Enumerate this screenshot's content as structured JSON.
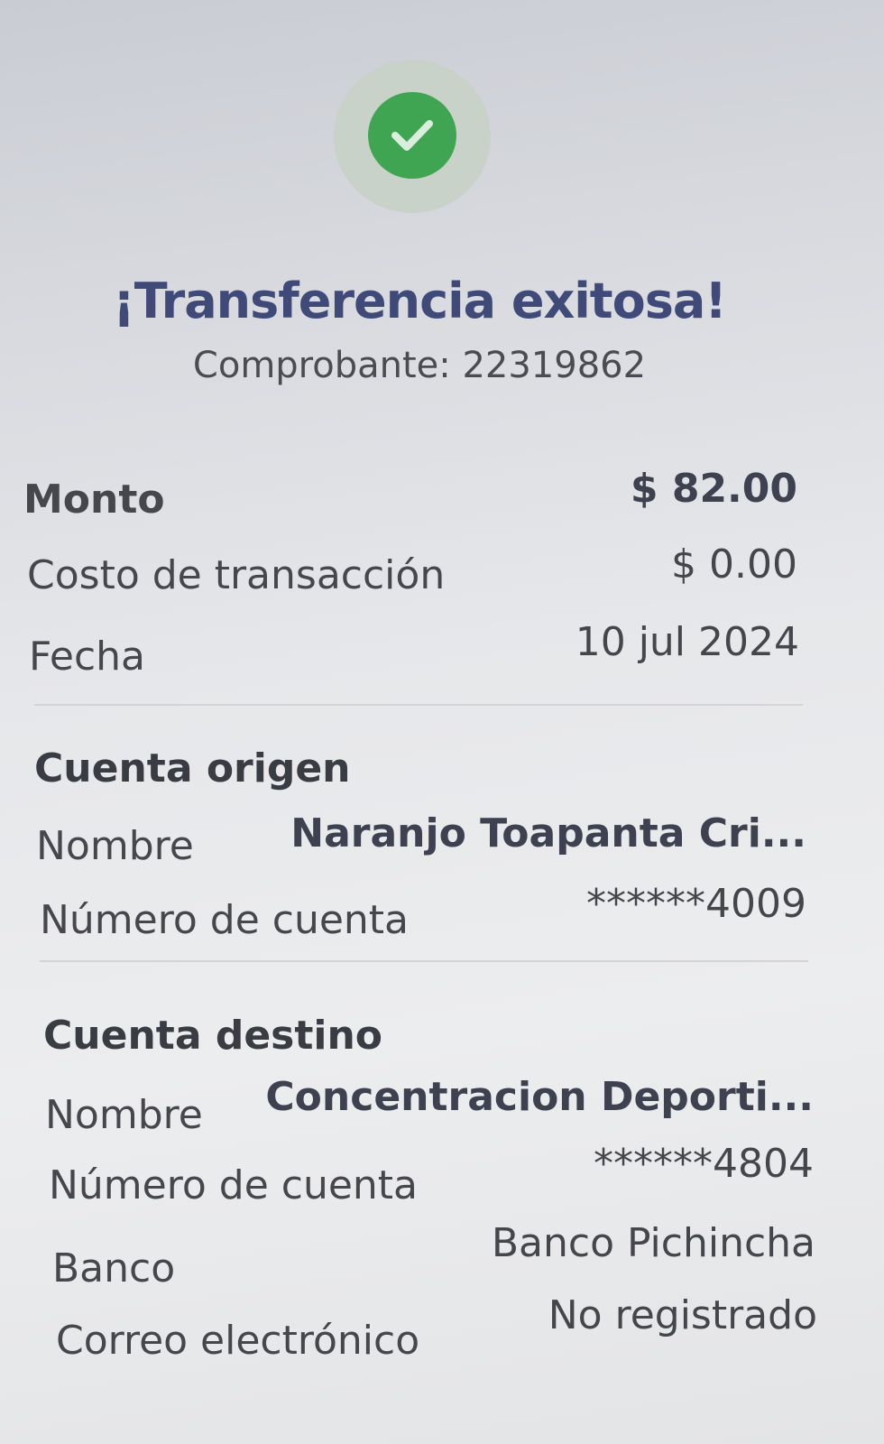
{
  "header": {
    "icon": "checkmark-icon",
    "title": "¡Transferencia exitosa!",
    "comprobante": "Comprobante: 22319862"
  },
  "summary": {
    "monto_label": "Monto",
    "monto_value": "$ 82.00",
    "costo_label": "Costo de transacción",
    "costo_value": "$ 0.00",
    "fecha_label": "Fecha",
    "fecha_value": "10 jul 2024"
  },
  "origen": {
    "title": "Cuenta origen",
    "nombre_label": "Nombre",
    "nombre_value": "Naranjo  Toapanta Cri...",
    "cuenta_label": "Número de cuenta",
    "cuenta_value": "******4009"
  },
  "destino": {
    "title": "Cuenta destino",
    "nombre_label": "Nombre",
    "nombre_value": "Concentracion Deporti...",
    "cuenta_label": "Número de cuenta",
    "cuenta_value": "******4804",
    "banco_label": "Banco",
    "banco_value": "Banco Pichincha",
    "correo_label": "Correo electrónico",
    "correo_value": "No registrado"
  },
  "colors": {
    "success_green": "#3fa552",
    "title_blue": "#3f4a78"
  }
}
